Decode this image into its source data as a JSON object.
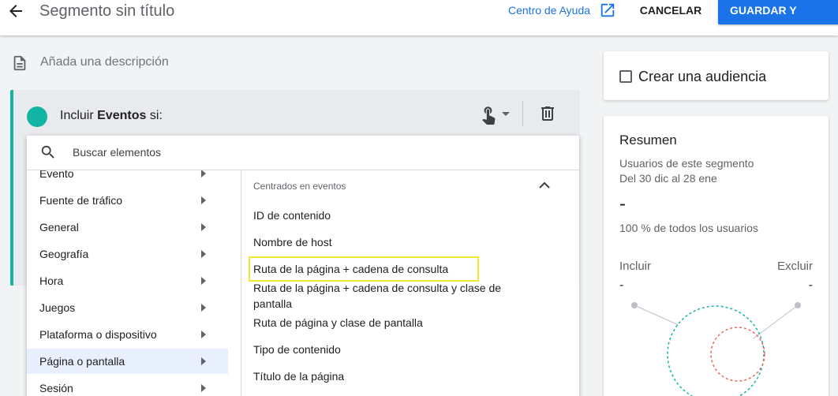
{
  "header": {
    "title": "Segmento sin título",
    "help_link": "Centro de Ayuda",
    "cancel_label": "CANCELAR",
    "save_label": "GUARDAR Y APLICAR"
  },
  "description": {
    "placeholder": "Añada una descripción"
  },
  "segment": {
    "prefix": "Incluir ",
    "entity": "Eventos",
    "suffix": " si:",
    "accent_color": "#12b5a3"
  },
  "dropdown": {
    "search_placeholder": "Buscar elementos",
    "categories": [
      {
        "label": "Evento",
        "selected": false
      },
      {
        "label": "Fuente de tráfico",
        "selected": false
      },
      {
        "label": "General",
        "selected": false
      },
      {
        "label": "Geografía",
        "selected": false
      },
      {
        "label": "Hora",
        "selected": false
      },
      {
        "label": "Juegos",
        "selected": false
      },
      {
        "label": "Plataforma o dispositivo",
        "selected": false
      },
      {
        "label": "Página o pantalla",
        "selected": true
      },
      {
        "label": "Sesión",
        "selected": false
      }
    ],
    "group_header": "Centrados en eventos",
    "fields": [
      "ID de contenido",
      "Nombre de host",
      "Ruta de la página + cadena de consulta",
      "Ruta de la página + cadena de consulta y clase de pantalla",
      "Ruta de página y clase de pantalla",
      "Tipo de contenido",
      "Título de la página"
    ],
    "highlighted_field_index": 2,
    "highlight_color": "#f4e731"
  },
  "audience": {
    "label": "Crear una audiencia"
  },
  "summary": {
    "title": "Resumen",
    "subtitle": "Usuarios de este segmento",
    "date_range": "Del 30 dic al 28 ene",
    "value": "-",
    "percent_text": "100 % de todos los usuarios",
    "include_label": "Incluir",
    "exclude_label": "Excluir",
    "include_value": "-",
    "exclude_value": "-",
    "include_color": "#12b5a3",
    "exclude_color": "#ee675c"
  },
  "colors": {
    "primary": "#1a73e8",
    "background": "#f1f3f4"
  }
}
